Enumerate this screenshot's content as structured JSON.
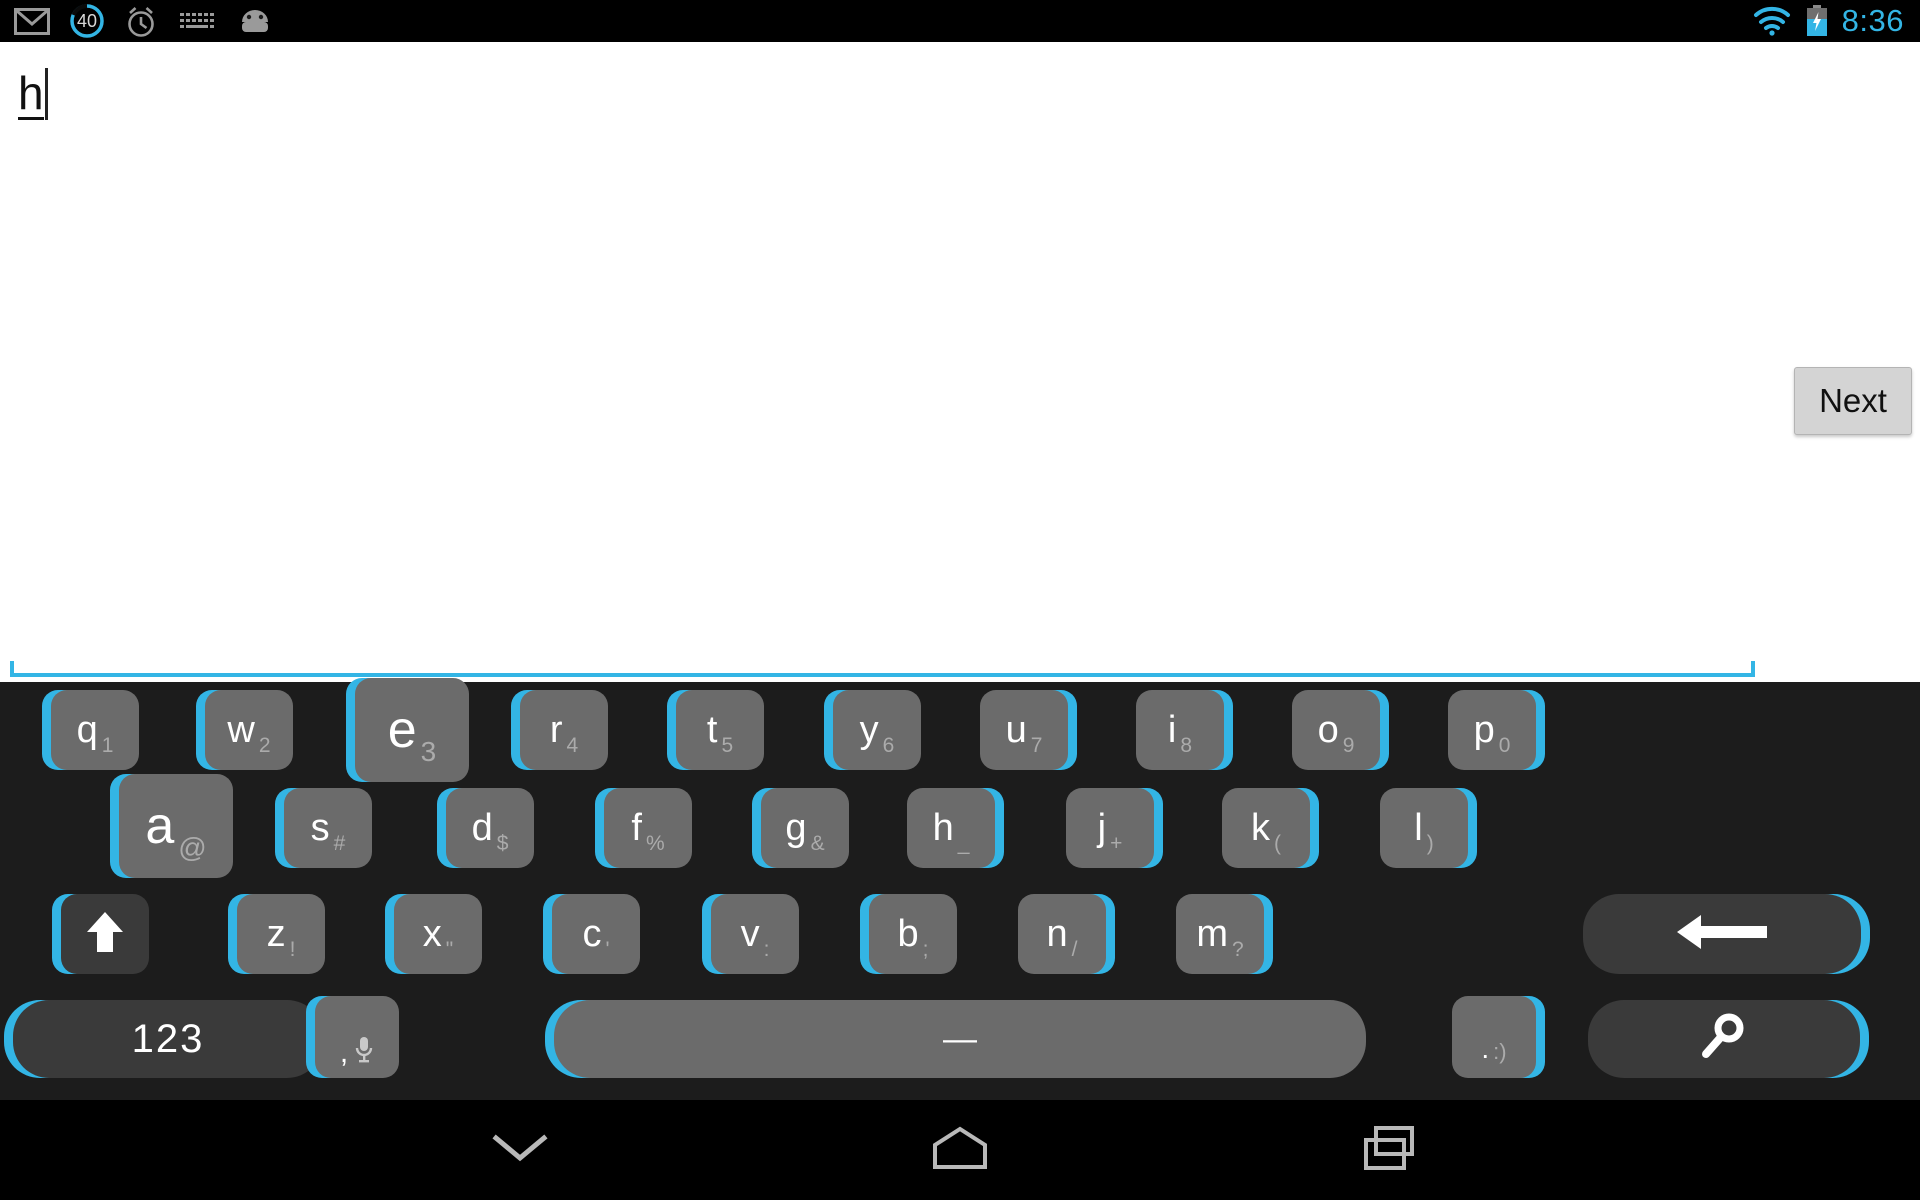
{
  "statusbar": {
    "time": "8:36",
    "time_color": "#33b5e5",
    "left_icons": [
      {
        "name": "gmail-icon",
        "label": "Gmail"
      },
      {
        "name": "download-progress-icon",
        "label": "40"
      },
      {
        "name": "alarm-clock-icon",
        "label": "Alarm"
      },
      {
        "name": "keyboard-icon",
        "label": "Keyboard"
      },
      {
        "name": "android-icon",
        "label": "Android"
      }
    ],
    "right_icons": [
      {
        "name": "wifi-icon",
        "label": "WiFi"
      },
      {
        "name": "battery-charging-icon",
        "label": "Charging"
      }
    ],
    "download_badge": "40"
  },
  "editor": {
    "composing_text": "h",
    "next_label": "Next",
    "underline_color": "#33b5e5"
  },
  "keyboard": {
    "accent_color": "#33b5e5",
    "key_face_color": "#6b6b6b",
    "key_dark_color": "#3a3a3a",
    "background_color": "#1c1c1c",
    "row1": [
      {
        "main": "q",
        "sub": "1",
        "name": "key-q",
        "shadow": "left"
      },
      {
        "main": "w",
        "sub": "2",
        "name": "key-w",
        "shadow": "left"
      },
      {
        "main": "e",
        "sub": "3",
        "name": "key-e",
        "shadow": "left",
        "magnified": true
      },
      {
        "main": "r",
        "sub": "4",
        "name": "key-r",
        "shadow": "left"
      },
      {
        "main": "t",
        "sub": "5",
        "name": "key-t",
        "shadow": "left"
      },
      {
        "main": "y",
        "sub": "6",
        "name": "key-y",
        "shadow": "left"
      },
      {
        "main": "u",
        "sub": "7",
        "name": "key-u",
        "shadow": "right"
      },
      {
        "main": "i",
        "sub": "8",
        "name": "key-i",
        "shadow": "right"
      },
      {
        "main": "o",
        "sub": "9",
        "name": "key-o",
        "shadow": "right"
      },
      {
        "main": "p",
        "sub": "0",
        "name": "key-p",
        "shadow": "right"
      }
    ],
    "row2": [
      {
        "main": "a",
        "sub": "@",
        "name": "key-a",
        "shadow": "left",
        "magnified": true
      },
      {
        "main": "s",
        "sub": "#",
        "name": "key-s",
        "shadow": "left"
      },
      {
        "main": "d",
        "sub": "$",
        "name": "key-d",
        "shadow": "left"
      },
      {
        "main": "f",
        "sub": "%",
        "name": "key-f",
        "shadow": "left"
      },
      {
        "main": "g",
        "sub": "&",
        "name": "key-g",
        "shadow": "left"
      },
      {
        "main": "h",
        "sub": "_",
        "name": "key-h",
        "shadow": "right"
      },
      {
        "main": "j",
        "sub": "+",
        "name": "key-j",
        "shadow": "right"
      },
      {
        "main": "k",
        "sub": "(",
        "name": "key-k",
        "shadow": "right"
      },
      {
        "main": "l",
        "sub": ")",
        "name": "key-l",
        "shadow": "right"
      }
    ],
    "row3": [
      {
        "main": "z",
        "sub": "!",
        "name": "key-z",
        "shadow": "left"
      },
      {
        "main": "x",
        "sub": "\"",
        "name": "key-x",
        "shadow": "left"
      },
      {
        "main": "c",
        "sub": "'",
        "name": "key-c",
        "shadow": "left"
      },
      {
        "main": "v",
        "sub": ":",
        "name": "key-v",
        "shadow": "left"
      },
      {
        "main": "b",
        "sub": ";",
        "name": "key-b",
        "shadow": "left"
      },
      {
        "main": "n",
        "sub": "/",
        "name": "key-n",
        "shadow": "right"
      },
      {
        "main": "m",
        "sub": "?",
        "name": "key-m",
        "shadow": "right"
      }
    ],
    "shift_key": {
      "name": "key-shift",
      "icon": "arrow-up-icon"
    },
    "backspace_key": {
      "name": "key-backspace",
      "icon": "backspace-arrow-icon"
    },
    "numbers_key": {
      "name": "key-numbers",
      "label": "123"
    },
    "comma_key": {
      "name": "key-comma",
      "main": ",",
      "icon": "microphone-icon"
    },
    "space_key": {
      "name": "key-space",
      "label": "—"
    },
    "period_key": {
      "name": "key-period",
      "main": ".",
      "sub": ":)"
    },
    "search_key": {
      "name": "key-search",
      "icon": "search-icon"
    }
  },
  "navbar": {
    "buttons": [
      {
        "name": "nav-hide-keyboard",
        "icon": "chevron-down-icon"
      },
      {
        "name": "nav-home",
        "icon": "home-icon"
      },
      {
        "name": "nav-recents",
        "icon": "recents-icon"
      }
    ]
  }
}
